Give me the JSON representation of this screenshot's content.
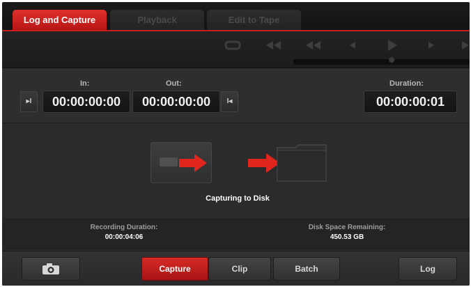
{
  "tabs": [
    {
      "label": "Log and Capture",
      "active": true
    },
    {
      "label": "Playback",
      "active": false
    },
    {
      "label": "Edit to Tape",
      "active": false
    }
  ],
  "transport": {
    "icons": [
      "loop-icon",
      "jump-to-start-icon",
      "rewind-icon",
      "step-back-icon",
      "play-icon",
      "step-forward-icon",
      "fast-forward-icon"
    ]
  },
  "timecode": {
    "in_label": "In:",
    "in_value": "00:00:00:00",
    "out_label": "Out:",
    "out_value": "00:00:00:00",
    "duration_label": "Duration:",
    "duration_value": "00:00:00:01",
    "mark_in_glyph": "▸I",
    "mark_out_glyph": "I◂"
  },
  "status": {
    "caption": "Capturing to Disk",
    "recording_label": "Recording Duration:",
    "recording_value": "00:00:04:06",
    "disk_label": "Disk Space Remaining:",
    "disk_value": "450.53 GB"
  },
  "bottom": {
    "capture_label": "Capture",
    "clip_label": "Clip",
    "batch_label": "Batch",
    "log_label": "Log"
  },
  "colors": {
    "accent": "#c81d1d",
    "panel": "#2b2b2d",
    "text": "#ffffff"
  }
}
